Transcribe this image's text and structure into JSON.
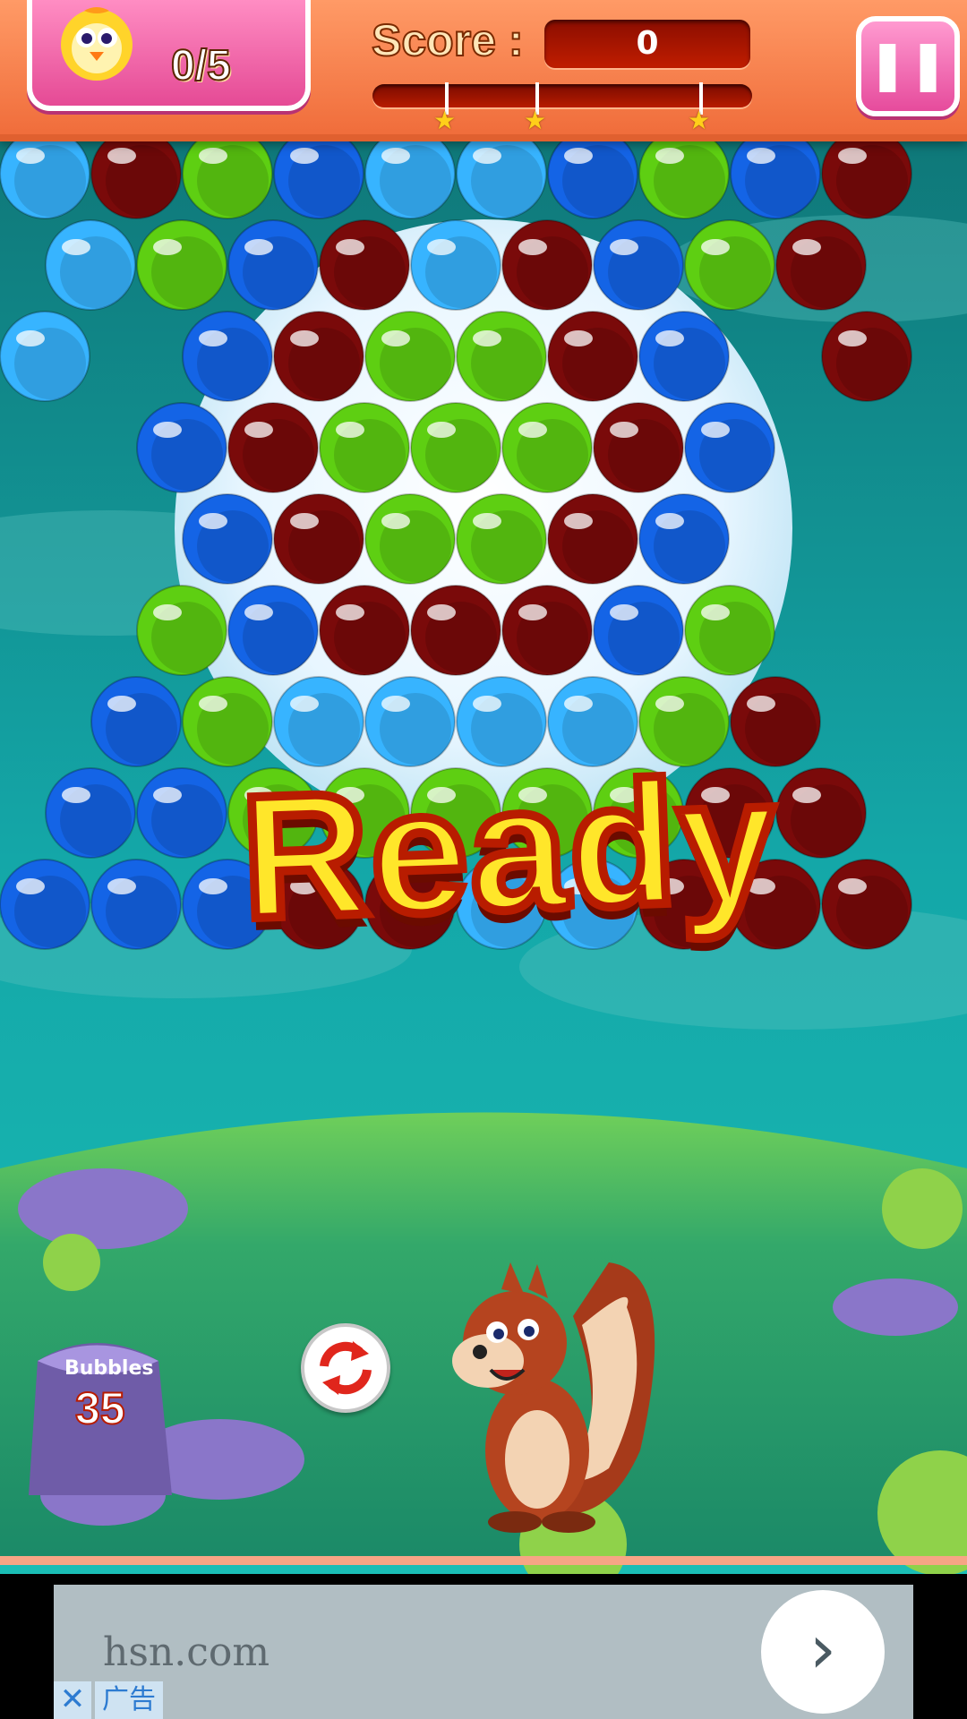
{
  "hud": {
    "goal_text": "0/5",
    "score_label": "Score :",
    "score_value": "0",
    "progress": 0,
    "pause_icon": "pause-icon",
    "star_icon": "star-icon"
  },
  "overlay": {
    "ready_text": "Ready"
  },
  "ammo": {
    "label": "Bubbles",
    "count": "35"
  },
  "swap_icon": "swap-arrows-icon",
  "character": "squirrel",
  "ad": {
    "url": "hsn.com",
    "tag": "广告",
    "close_icon": "close-icon",
    "go_icon": "chevron-right-icon"
  },
  "colors": {
    "L": "#37b4ff",
    "B": "#1464e6",
    "R": "#7a0a0a",
    "G": "#5ecf12"
  },
  "board": [
    "LRGBLLBGBR",
    "LGBRLRBGR",
    "L.BRGGRB.R",
    ".BRGGGRB.",
    "..BRGGRB..",
    ".GBRRRBG.",
    ".BGLLLLGR.",
    "BBGGGGGRR",
    "BBBRRLLRRR"
  ]
}
